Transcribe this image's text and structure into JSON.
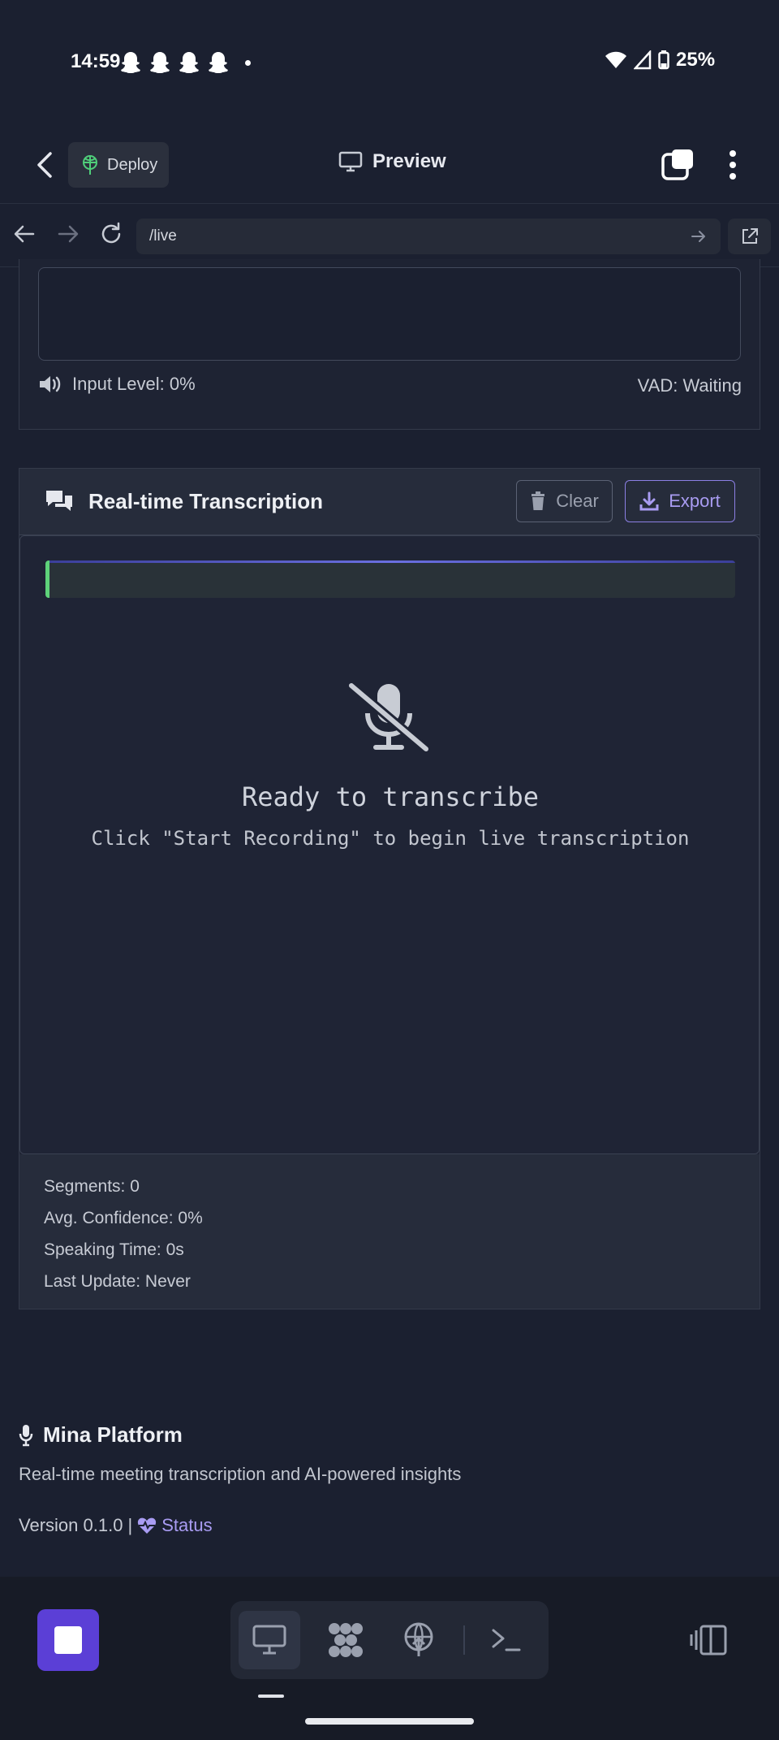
{
  "status_bar": {
    "time": "14:59",
    "battery": "25%"
  },
  "app_bar": {
    "deploy_label": "Deploy",
    "preview_label": "Preview"
  },
  "url_bar": {
    "path": "/live"
  },
  "audio": {
    "input_level": "Input Level: 0%",
    "vad": "VAD: Waiting"
  },
  "transcription": {
    "title": "Real-time Transcription",
    "clear_label": "Clear",
    "export_label": "Export",
    "empty_title": "Ready to transcribe",
    "empty_subtitle": "Click \"Start Recording\" to begin live transcription",
    "stats": [
      "Segments: 0",
      "Avg. Confidence: 0%",
      "Speaking Time: 0s",
      "Last Update: Never"
    ]
  },
  "footer": {
    "brand": "Mina Platform",
    "description": "Real-time meeting transcription and AI-powered insights",
    "version": "Version 0.1.0 |",
    "status_link": "Status"
  },
  "colors": {
    "accent": "#5b3fd6",
    "link": "#a99cf2",
    "success": "#5ed27a"
  }
}
